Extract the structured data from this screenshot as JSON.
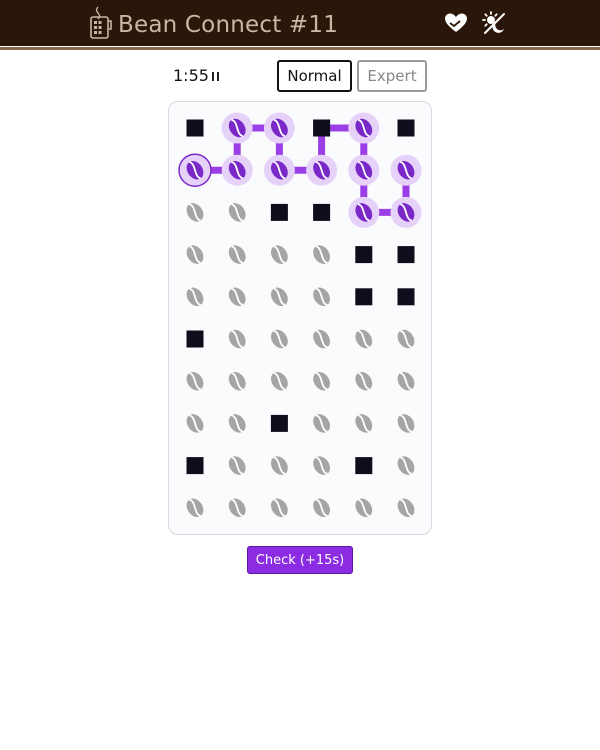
{
  "header": {
    "title": "Bean Connect #11",
    "logo_icon": "coffee-cup-icon",
    "icons": [
      "heart-hand-icon",
      "theme-toggle-icon"
    ],
    "background": "#2b1709",
    "title_color": "#c9b6a4"
  },
  "controls": {
    "timer": "1:55",
    "pause_icon": "pause-icon",
    "modes": [
      {
        "label": "Normal",
        "selected": true
      },
      {
        "label": "Expert",
        "selected": false
      }
    ]
  },
  "board": {
    "rows": 10,
    "cols": 6,
    "cells": [
      "#BB#B#",
      "SBBBBB",
      "BB##BB",
      "BBBB##",
      "BBBB##",
      "#BBBBB",
      "BBBBBB",
      "BB#BBB",
      "#BBB#B",
      "BBBBBB"
    ],
    "legend": {
      "#": "blocked",
      "B": "bean",
      "S": "start-bean"
    },
    "path": [
      [
        1,
        0
      ],
      [
        1,
        1
      ],
      [
        0,
        1
      ],
      [
        0,
        2
      ],
      [
        1,
        2
      ],
      [
        1,
        3
      ],
      [
        0,
        3
      ],
      [
        0,
        4
      ],
      [
        1,
        4
      ],
      [
        2,
        4
      ],
      [
        2,
        5
      ],
      [
        1,
        5
      ]
    ],
    "colors": {
      "path": "#9b3ee6",
      "bean_active_bg": "#e6d2f8",
      "bean_active": "#7b28c9",
      "bean_inactive": "#a5a5a5",
      "blocked": "#0d0d1c"
    }
  },
  "actions": {
    "check_label": "Check (+15s)"
  }
}
